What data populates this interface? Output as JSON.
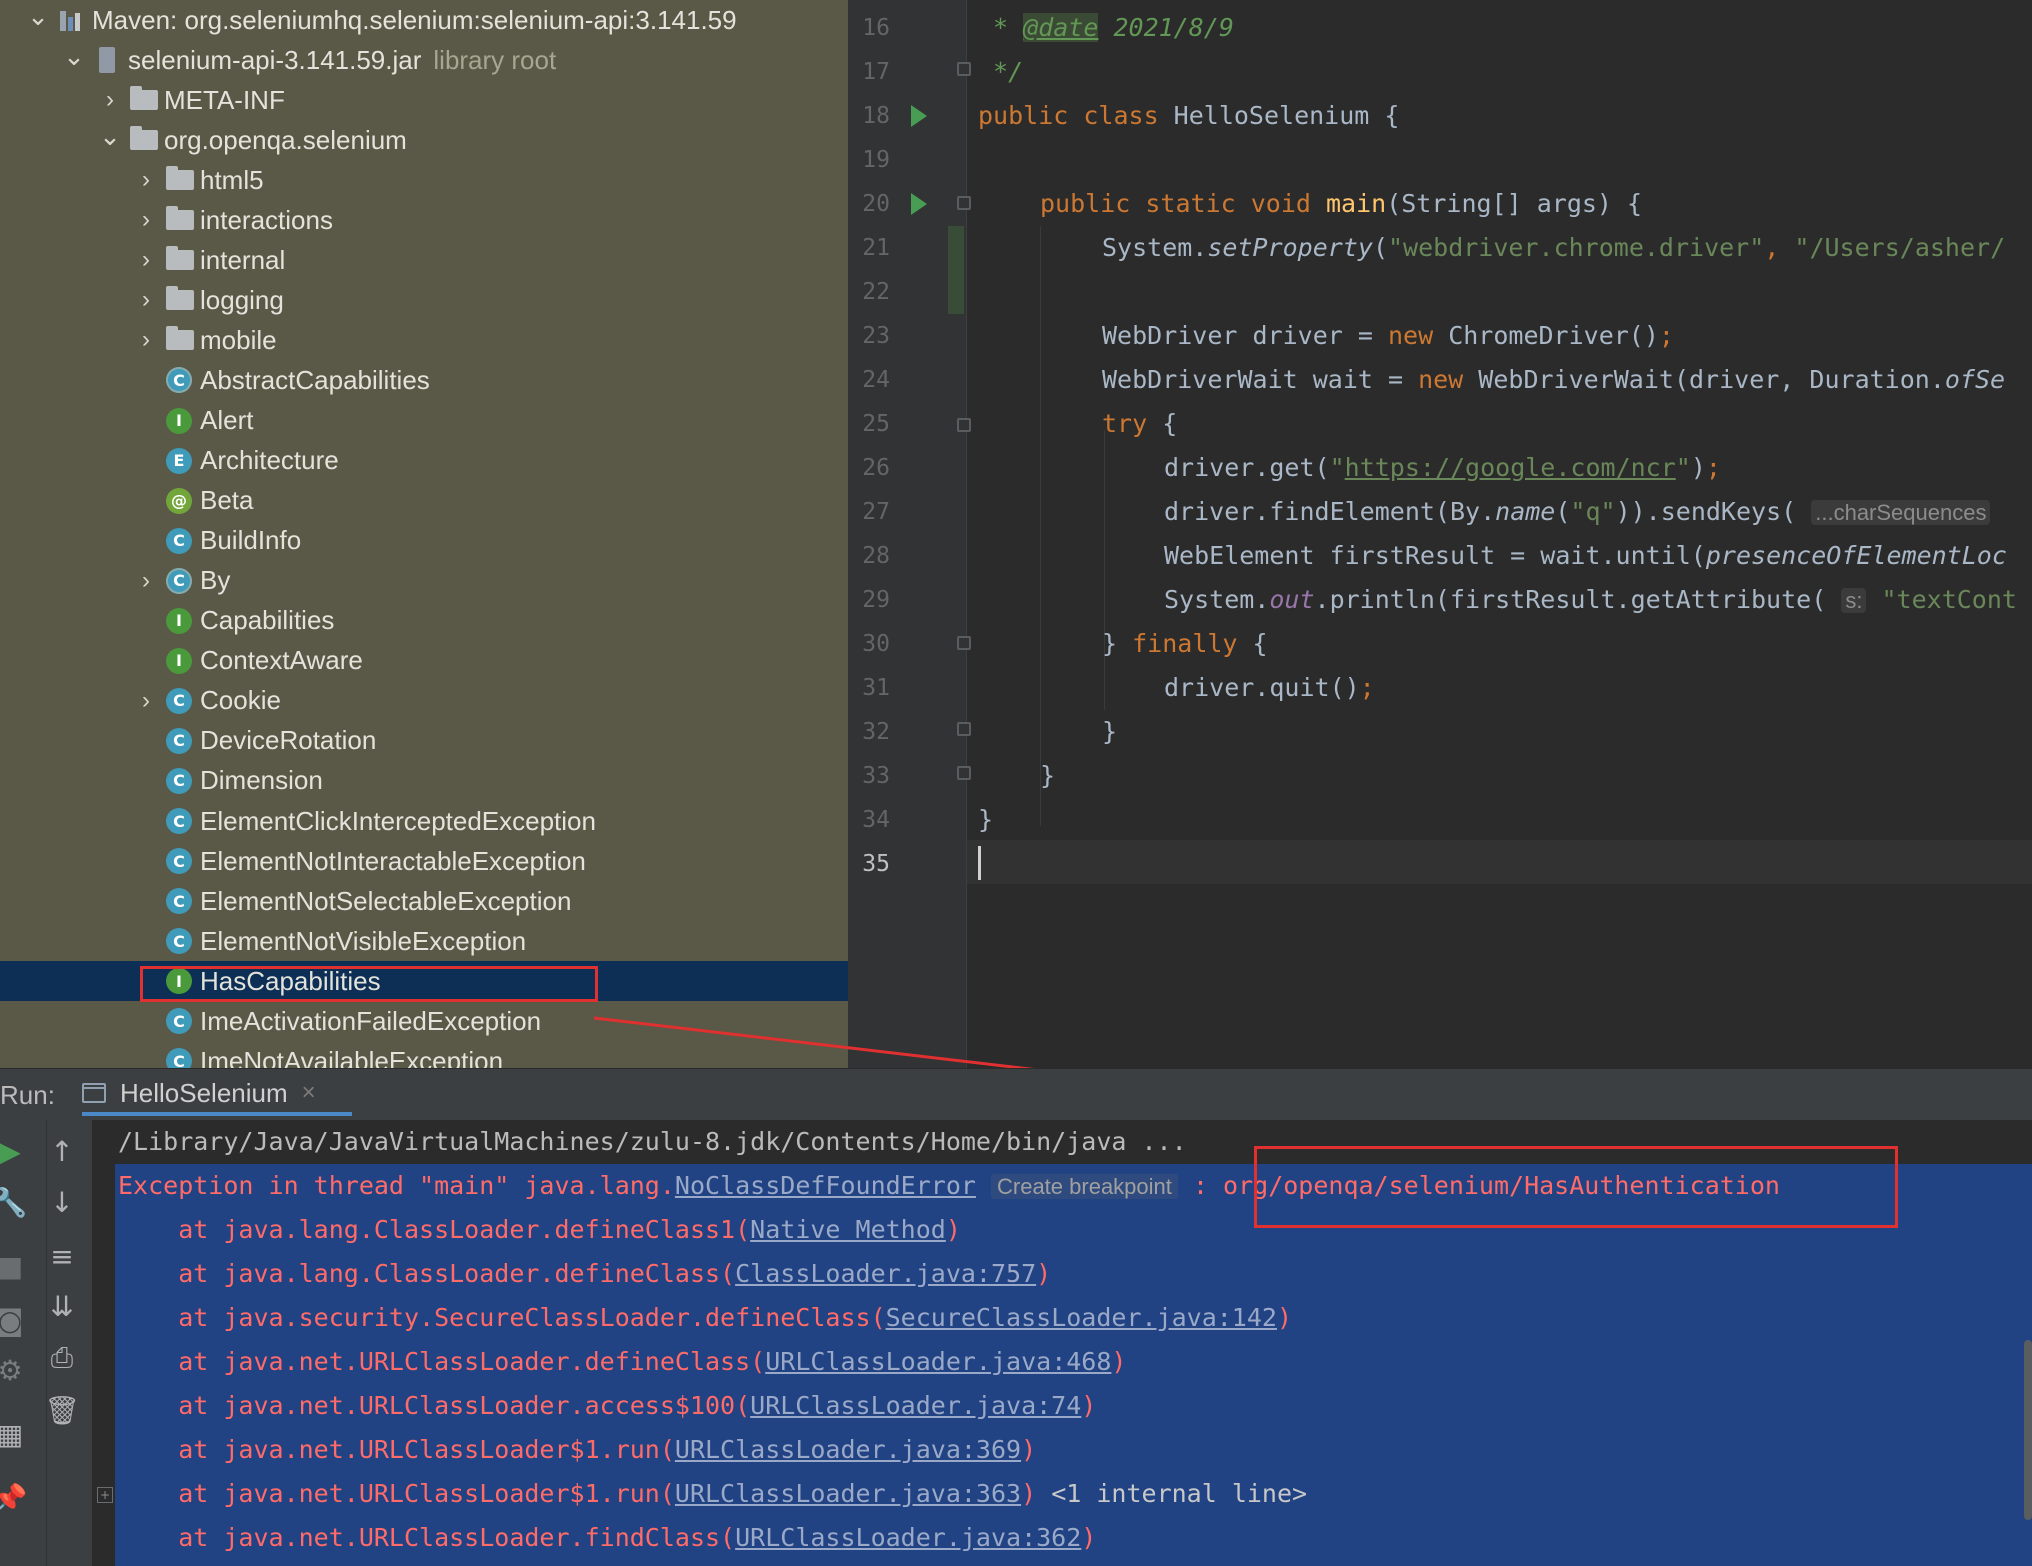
{
  "project_tree": {
    "items": [
      {
        "label": "Maven: org.seleniumhq.selenium:selenium-api:3.141.59",
        "icon": "maven-library-icon",
        "expanded": true
      },
      {
        "label": "selenium-api-3.141.59.jar",
        "suffix": "library root",
        "icon": "jar-icon",
        "expanded": true
      },
      {
        "label": "META-INF",
        "icon": "folder-icon",
        "expanded": false
      },
      {
        "label": "org.openqa.selenium",
        "icon": "folder-icon",
        "expanded": true
      },
      {
        "label": "html5",
        "icon": "folder-icon",
        "expanded": false
      },
      {
        "label": "interactions",
        "icon": "folder-icon",
        "expanded": false
      },
      {
        "label": "internal",
        "icon": "folder-icon",
        "expanded": false
      },
      {
        "label": "logging",
        "icon": "folder-icon",
        "expanded": false
      },
      {
        "label": "mobile",
        "icon": "folder-icon",
        "expanded": false
      },
      {
        "label": "AbstractCapabilities",
        "icon": "abstract-class-icon",
        "badge": "C"
      },
      {
        "label": "Alert",
        "icon": "interface-icon",
        "badge": "I"
      },
      {
        "label": "Architecture",
        "icon": "enum-icon",
        "badge": "E"
      },
      {
        "label": "Beta",
        "icon": "annotation-icon",
        "badge": "@"
      },
      {
        "label": "BuildInfo",
        "icon": "class-icon",
        "badge": "C"
      },
      {
        "label": "By",
        "icon": "abstract-class-icon",
        "badge": "C",
        "expandable": true
      },
      {
        "label": "Capabilities",
        "icon": "interface-icon",
        "badge": "I"
      },
      {
        "label": "ContextAware",
        "icon": "interface-icon",
        "badge": "I"
      },
      {
        "label": "Cookie",
        "icon": "class-icon",
        "badge": "C",
        "expandable": true
      },
      {
        "label": "DeviceRotation",
        "icon": "class-icon",
        "badge": "C"
      },
      {
        "label": "Dimension",
        "icon": "class-icon",
        "badge": "C"
      },
      {
        "label": "ElementClickInterceptedException",
        "icon": "class-icon",
        "badge": "C"
      },
      {
        "label": "ElementNotInteractableException",
        "icon": "class-icon",
        "badge": "C"
      },
      {
        "label": "ElementNotSelectableException",
        "icon": "class-icon",
        "badge": "C"
      },
      {
        "label": "ElementNotVisibleException",
        "icon": "class-icon",
        "badge": "C"
      },
      {
        "label": "HasCapabilities",
        "icon": "interface-icon",
        "badge": "I",
        "selected": true
      },
      {
        "label": "ImeActivationFailedException",
        "icon": "class-icon",
        "badge": "C"
      },
      {
        "label": "ImeNotAvailableException",
        "icon": "class-icon",
        "badge": "C"
      }
    ]
  },
  "editor": {
    "line_numbers": [
      "16",
      "17",
      "18",
      "19",
      "20",
      "21",
      "22",
      "23",
      "24",
      "25",
      "26",
      "27",
      "28",
      "29",
      "30",
      "31",
      "32",
      "33",
      "34",
      "35"
    ],
    "current_line": "35",
    "code": {
      "l16_star": " * ",
      "l16_tag": "@date",
      "l16_val": " 2021/8/9",
      "l17": " */",
      "l18_kw": "public class ",
      "l18_name": "HelloSelenium",
      "l18_rest": " {",
      "l20_kw": "public static void ",
      "l20_fn": "main",
      "l20_rest": "(String[] args) {",
      "l21_a": "System.",
      "l21_fn": "setProperty",
      "l21_b": "(",
      "l21_s1": "\"webdriver.chrome.driver\"",
      "l21_c": ", ",
      "l21_s2": "\"/Users/asher/",
      "l23_a": "WebDriver driver = ",
      "l23_kw": "new",
      "l23_b": " ChromeDriver()",
      "l23_semi": ";",
      "l24_a": "WebDriverWait wait = ",
      "l24_kw": "new",
      "l24_b": " WebDriverWait(driver, Duration.",
      "l24_it": "ofSe",
      "l25_kw": "try",
      "l25_rest": " {",
      "l26_a": "driver.get(",
      "l26_q1": "\"",
      "l26_url": "https://google.com/ncr",
      "l26_q2": "\"",
      "l26_b": ")",
      "l26_semi": ";",
      "l27_a": "driver.findElement(By.",
      "l27_it": "name",
      "l27_b": "(",
      "l27_s": "\"q\"",
      "l27_c": ")).sendKeys( ",
      "l27_hint": "...charSequences",
      "l28_a": "WebElement firstResult = wait.until(",
      "l28_it": "presenceOfElementLoc",
      "l29_a": "System.",
      "l29_fld": "out",
      "l29_b": ".println(firstResult.getAttribute( ",
      "l29_hint": "s:",
      "l29_s": " \"textCont",
      "l30_a": "} ",
      "l30_kw": "finally",
      "l30_b": " {",
      "l31_a": "driver.quit()",
      "l31_semi": ";",
      "l32": "}",
      "l33": "}",
      "l34": "}"
    }
  },
  "run_panel": {
    "title": "Run:",
    "tab_label": "HelloSelenium",
    "tab_close": "×",
    "toolbar_icons": [
      "run-icon",
      "up-arrow-icon",
      "wrench-icon",
      "down-arrow-icon",
      "stop-icon",
      "soft-wrap-icon",
      "camera-icon",
      "scroll-to-end-icon",
      "settings-icon",
      "print-icon",
      "layout-icon",
      "trash-icon",
      "pin-icon"
    ],
    "console": {
      "line0": "/Library/Java/JavaVirtualMachines/zulu-8.jdk/Contents/Home/bin/java ...",
      "line1_a": "Exception in thread \"main\" java.lang.",
      "line1_link": "NoClassDefFoundError",
      "line1_hint": "Create breakpoint",
      "line1_b": " : ",
      "line1_c": "org/openqa/selenium/HasAuthentication",
      "frames": [
        {
          "prefix": "    at java.lang.ClassLoader.defineClass1(",
          "link": "Native Method",
          "suffix": ")",
          "extra": ""
        },
        {
          "prefix": "    at java.lang.ClassLoader.defineClass(",
          "link": "ClassLoader.java:757",
          "suffix": ")",
          "extra": ""
        },
        {
          "prefix": "    at java.security.SecureClassLoader.defineClass(",
          "link": "SecureClassLoader.java:142",
          "suffix": ")",
          "extra": ""
        },
        {
          "prefix": "    at java.net.URLClassLoader.defineClass(",
          "link": "URLClassLoader.java:468",
          "suffix": ")",
          "extra": ""
        },
        {
          "prefix": "    at java.net.URLClassLoader.access$100(",
          "link": "URLClassLoader.java:74",
          "suffix": ")",
          "extra": ""
        },
        {
          "prefix": "    at java.net.URLClassLoader$1.run(",
          "link": "URLClassLoader.java:369",
          "suffix": ")",
          "extra": ""
        },
        {
          "prefix": "    at java.net.URLClassLoader$1.run(",
          "link": "URLClassLoader.java:363",
          "suffix": ")",
          "extra": " <1 internal line>"
        },
        {
          "prefix": "    at java.net.URLClassLoader.findClass(",
          "link": "URLClassLoader.java:362",
          "suffix": ")",
          "extra": ""
        }
      ]
    }
  },
  "colors": {
    "tree_bg": "#5a5846",
    "selection": "#0d2f55",
    "console_selection": "#214283",
    "error_red": "#ff6b68",
    "annotation_red": "#e03030"
  }
}
